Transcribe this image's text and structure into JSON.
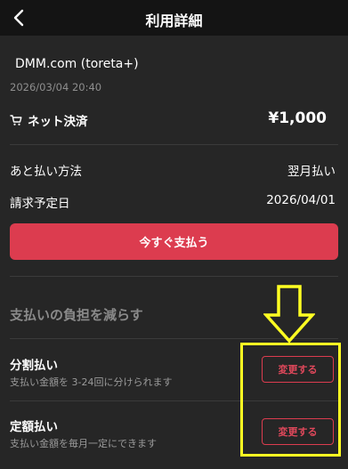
{
  "header": {
    "title": "利用詳細"
  },
  "transaction": {
    "merchant": "DMM.com (toreta+)",
    "datetime": "2026/03/04 20:40",
    "type_label": "ネット決済",
    "amount": "¥1,000"
  },
  "details": [
    {
      "label": "あと払い方法",
      "value": "翌月払い"
    },
    {
      "label": "請求予定日",
      "value": "2026/04/01"
    }
  ],
  "pay_button": {
    "label": "今すぐ支払う"
  },
  "section": {
    "title": "支払いの負担を減らす"
  },
  "plans": [
    {
      "title": "分割払い",
      "description": "支払い金額を 3-24回に分けられます",
      "button_label": "変更する"
    },
    {
      "title": "定額払い",
      "description": "支払い金額を毎月一定にできます",
      "button_label": "変更する"
    }
  ],
  "colors": {
    "accent": "#dc3c4f",
    "highlight": "#ffff22",
    "background": "#262626",
    "header_background": "#141414"
  },
  "icons": {
    "back": "chevron-left-icon",
    "cart": "cart-icon",
    "annotation": "arrow-down-icon"
  }
}
